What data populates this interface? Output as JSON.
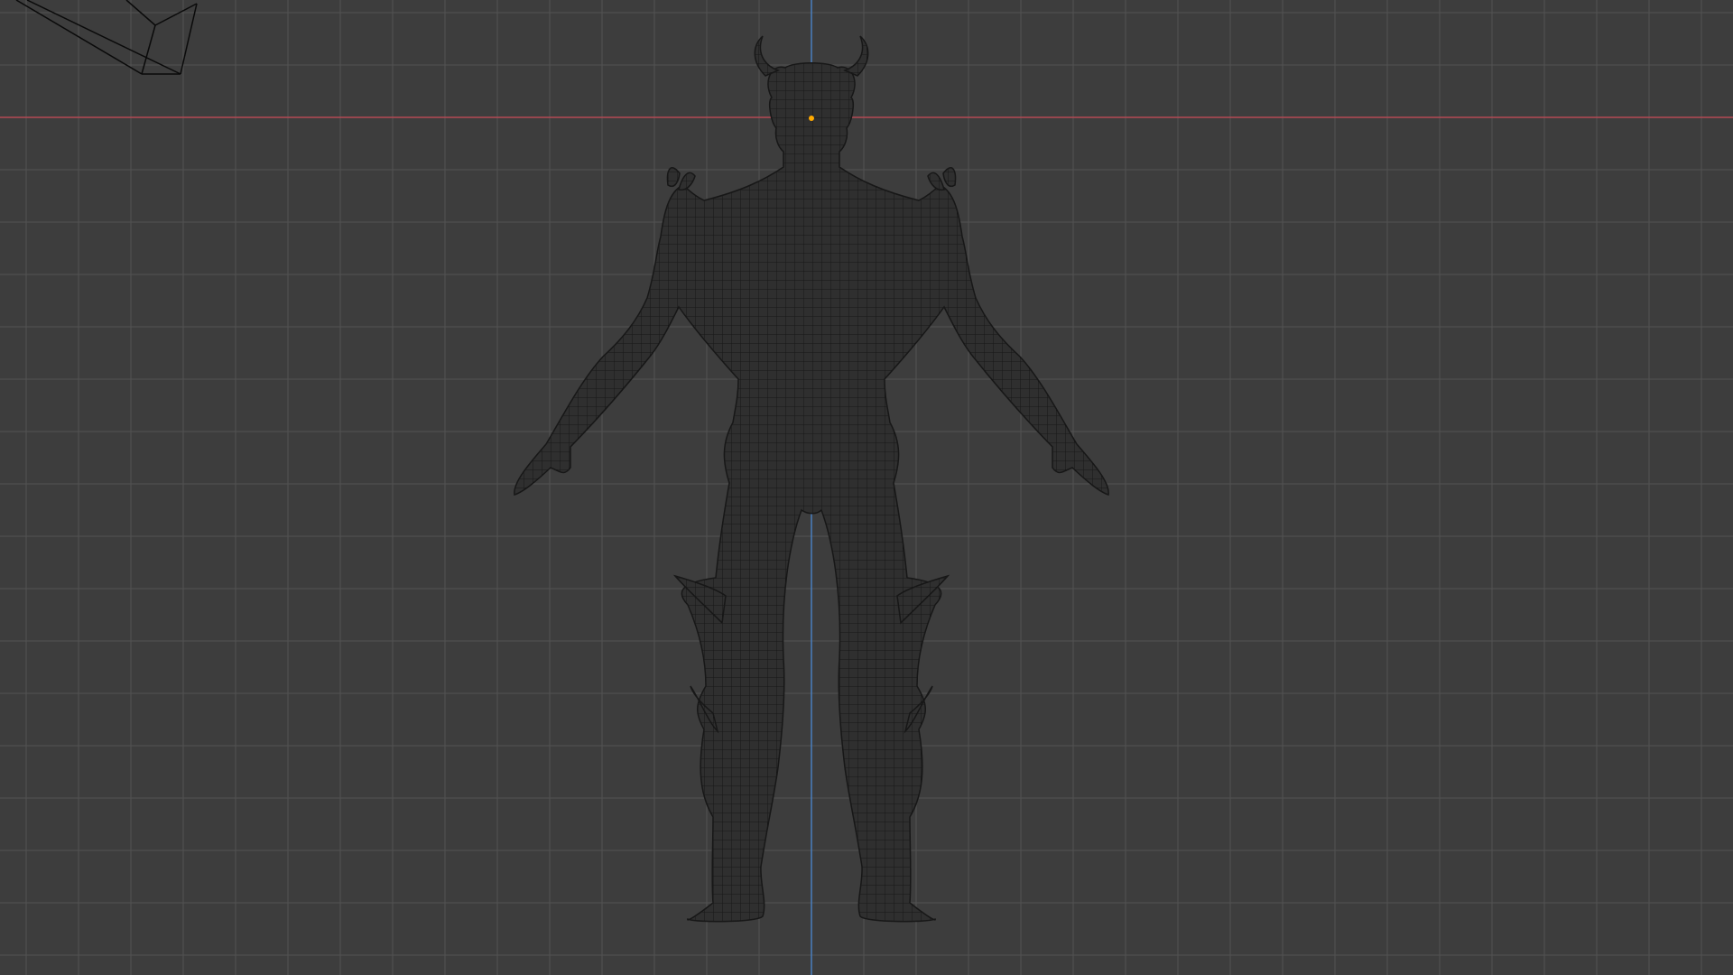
{
  "viewport": {
    "background_color": "#3d3d3d",
    "grid_color": "#525252",
    "axis_x_color": "#b34a55",
    "axis_y_color": "#4a7fbf",
    "mesh_fill": "#2f2f2f",
    "mesh_line": "#171717",
    "origin_color": "#ffaa00",
    "camera_line": "#0a0a0a"
  },
  "objects": {
    "camera": {
      "icon": "camera-wireframe-icon"
    },
    "character": {
      "icon": "character-mesh-icon",
      "display": "wireframe"
    },
    "origin": {
      "icon": "origin-point-icon"
    }
  }
}
